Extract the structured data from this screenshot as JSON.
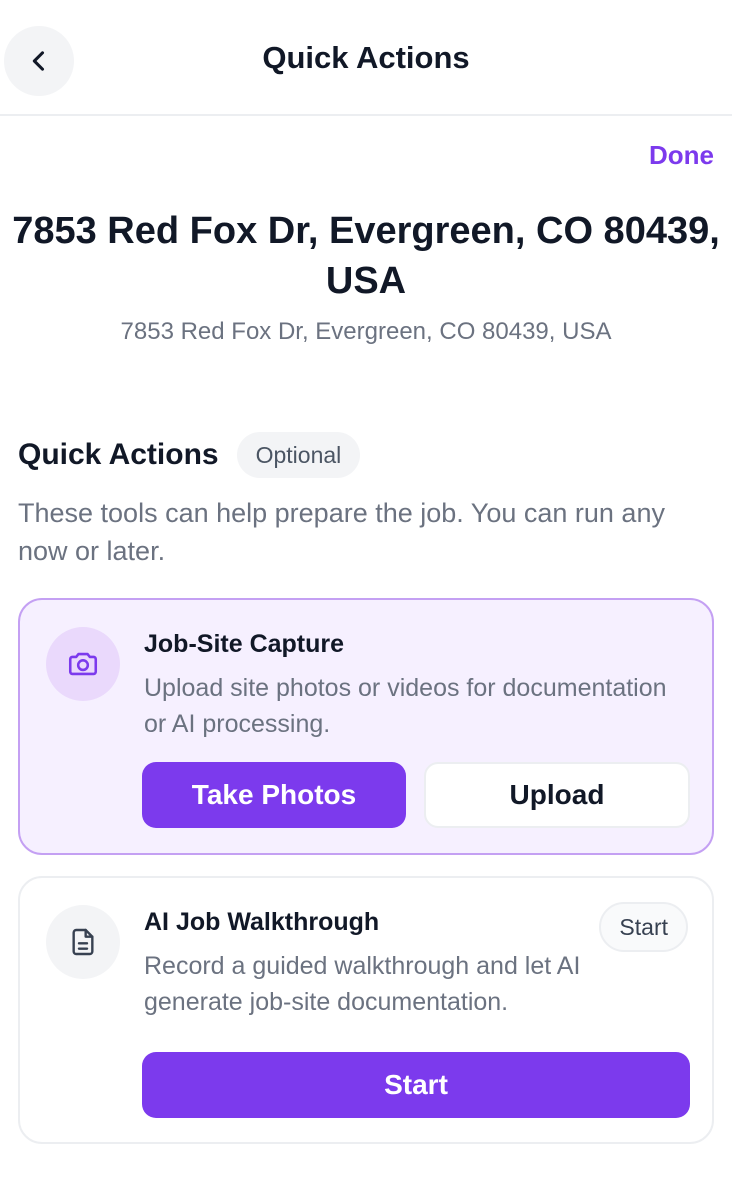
{
  "header": {
    "title": "Quick Actions",
    "back_icon": "chevron-left-icon"
  },
  "done_label": "Done",
  "address": {
    "title": "7853 Red Fox Dr, Evergreen, CO 80439, USA",
    "subtitle": "7853 Red Fox Dr, Evergreen, CO 80439, USA"
  },
  "quick_actions": {
    "title": "Quick Actions",
    "badge": "Optional",
    "description": "These tools can help prepare the job. You can run any now or later."
  },
  "cards": [
    {
      "icon": "camera-icon",
      "title": "Job-Site Capture",
      "description": "Upload site photos or videos for documentation or AI processing.",
      "primary_label": "Take Photos",
      "secondary_label": "Upload"
    },
    {
      "icon": "document-icon",
      "title": "AI Job Walkthrough",
      "pill_label": "Start",
      "description": "Record a guided walkthrough and let AI generate job-site documentation.",
      "primary_label": "Start"
    }
  ],
  "colors": {
    "accent": "#7c3aed",
    "card_highlight_bg": "#f6f0ff",
    "card_highlight_border": "#c4a0f3",
    "muted_text": "#6b7280"
  }
}
